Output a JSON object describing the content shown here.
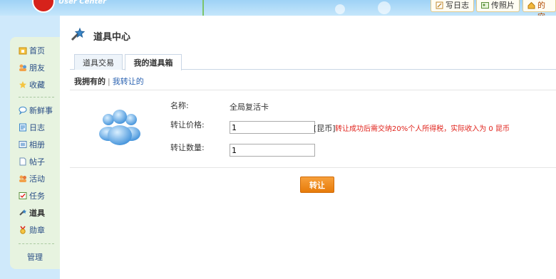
{
  "header": {
    "logo_text": "User Center",
    "buttons": [
      {
        "label": "写日志",
        "icon": "pencil-icon"
      },
      {
        "label": "传照片",
        "icon": "photo-icon"
      },
      {
        "label": "我的空",
        "icon": "home-icon"
      }
    ]
  },
  "sidebar": {
    "items": [
      {
        "label": "首页",
        "icon": "home-icon"
      },
      {
        "label": "朋友",
        "icon": "friends-icon"
      },
      {
        "label": "收藏",
        "icon": "star-icon"
      },
      {
        "label": "新鲜事",
        "icon": "speech-bubble-icon"
      },
      {
        "label": "日志",
        "icon": "notebook-icon"
      },
      {
        "label": "相册",
        "icon": "album-icon"
      },
      {
        "label": "帖子",
        "icon": "document-icon"
      },
      {
        "label": "活动",
        "icon": "people-icon"
      },
      {
        "label": "任务",
        "icon": "task-icon"
      },
      {
        "label": "道具",
        "icon": "magic-wand-icon"
      },
      {
        "label": "勋章",
        "icon": "medal-icon"
      }
    ],
    "manage_label": "管理",
    "active": "道具"
  },
  "main": {
    "title": "道具中心",
    "tabs": [
      {
        "label": "道具交易",
        "active": false
      },
      {
        "label": "我的道具箱",
        "active": true
      }
    ],
    "subnav": {
      "current": "我拥有的",
      "separator": "|",
      "link": "我转让的"
    },
    "form": {
      "name_label": "名称:",
      "name_value": "全局复活卡",
      "price_label": "转让价格:",
      "price_value": "1",
      "price_unit": "[昆币]",
      "price_note": "转让成功后需交纳20%个人所得税，实际收入为 0 昆币",
      "quantity_label": "转让数量:",
      "quantity_value": "1",
      "submit_label": "转让"
    }
  },
  "colors": {
    "accent": "#e77b0a",
    "warning": "#e0221b",
    "link": "#2a62b1",
    "sidebar_bg": "#e7f3e0"
  }
}
